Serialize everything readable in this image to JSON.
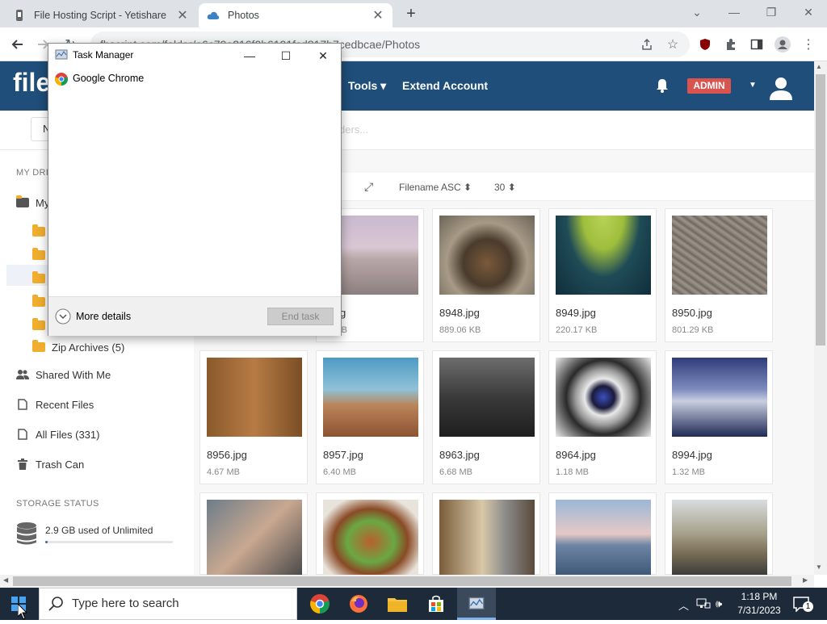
{
  "browser": {
    "tabs": [
      {
        "title": "File Hosting Script - Yetishare",
        "active": false
      },
      {
        "title": "Photos",
        "active": true
      }
    ],
    "url": "fhscript.com/folder/e6c79e216f0b6191fcd817b7cedbcae/Photos"
  },
  "app": {
    "logo": "file",
    "nav": {
      "tools": "Tools ▾",
      "extend": "Extend Account"
    },
    "admin_badge": "ADMIN",
    "new_button": "N",
    "search_placeholder": "ders..."
  },
  "sidebar": {
    "my_drive_heading": "MY DRI",
    "my_files_label": "My",
    "zip_archives": "Zip Archives (5)",
    "shared": "Shared With Me",
    "recent": "Recent Files",
    "all_files": "All Files (331)",
    "trash": "Trash Can",
    "storage_heading": "STORAGE STATUS",
    "storage_text": "2.9 GB used of Unlimited"
  },
  "sortbar": {
    "sort": "Filename ASC",
    "per_page": "30"
  },
  "files": [
    {
      "name": "7.jpg",
      "size": "27 KB"
    },
    {
      "name": "8948.jpg",
      "size": "889.06 KB"
    },
    {
      "name": "8949.jpg",
      "size": "220.17 KB"
    },
    {
      "name": "8950.jpg",
      "size": "801.29 KB"
    },
    {
      "name": "8956.jpg",
      "size": "4.67 MB"
    },
    {
      "name": "8957.jpg",
      "size": "6.40 MB"
    },
    {
      "name": "8963.jpg",
      "size": "6.68 MB"
    },
    {
      "name": "8964.jpg",
      "size": "1.18 MB"
    },
    {
      "name": "8994.jpg",
      "size": "1.32 MB"
    }
  ],
  "taskmanager": {
    "title": "Task Manager",
    "app": "Google Chrome",
    "more_details": "More details",
    "end_task": "End task"
  },
  "taskbar": {
    "search_placeholder": "Type here to search",
    "time": "1:18 PM",
    "date": "7/31/2023",
    "notification_count": "1"
  },
  "colors": {
    "header": "#1e4e79",
    "admin": "#d9534f",
    "folder": "#f0ad2e"
  }
}
